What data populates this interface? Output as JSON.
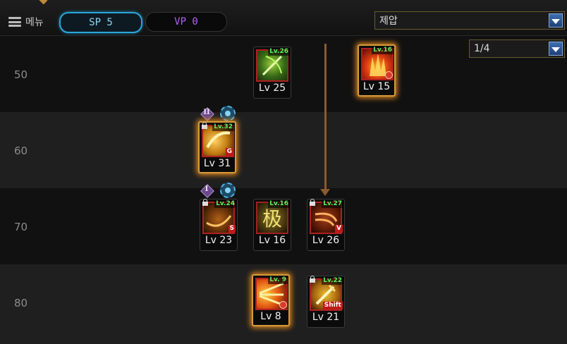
{
  "toolbar": {
    "menu_label": "메뉴",
    "sp_label": "SP 5",
    "vp_label": "VP 0",
    "category_select": "제압",
    "page_select": "1/4"
  },
  "rows": [
    {
      "label": "50"
    },
    {
      "label": "60"
    },
    {
      "label": "70"
    },
    {
      "label": "80"
    }
  ],
  "skills": [
    {
      "badge": "Lv.26",
      "level": "Lv 25",
      "locked": false,
      "corner": "",
      "clock": false,
      "glow": false,
      "art": "green-bow"
    },
    {
      "badge": "Lv.16",
      "level": "Lv 15",
      "locked": false,
      "corner": "",
      "clock": true,
      "glow": true,
      "art": "fire-burst"
    },
    {
      "badge": "Lv.32",
      "level": "Lv 31",
      "locked": true,
      "corner": "G",
      "clock": false,
      "glow": true,
      "art": "golden-slash"
    },
    {
      "badge": "Lv.24",
      "level": "Lv 23",
      "locked": true,
      "corner": "S",
      "clock": false,
      "glow": false,
      "art": "arc-slash"
    },
    {
      "badge": "Lv.16",
      "level": "Lv 16",
      "locked": false,
      "corner": "",
      "clock": false,
      "glow": false,
      "art": "kanji-kyoku"
    },
    {
      "badge": "Lv.27",
      "level": "Lv 26",
      "locked": true,
      "corner": "V",
      "clock": false,
      "glow": false,
      "art": "wind-slash"
    },
    {
      "badge": "Lv. 9",
      "level": "Lv 8",
      "locked": false,
      "corner": "",
      "clock": true,
      "glow": true,
      "art": "ray-burst"
    },
    {
      "badge": "Lv.22",
      "level": "Lv 21",
      "locked": true,
      "corner": "Shift",
      "clock": false,
      "glow": false,
      "art": "golden-sword"
    }
  ],
  "tier_markers": [
    {
      "roman": "II",
      "icon": "tier-2-icon"
    },
    {
      "roman": "I",
      "icon": "tier-1-icon"
    }
  ],
  "colors": {
    "level_badge": "#5ef05e",
    "glow": "#e08a20",
    "sp_border": "#2aa5d8",
    "vp_text": "#b060ff"
  }
}
